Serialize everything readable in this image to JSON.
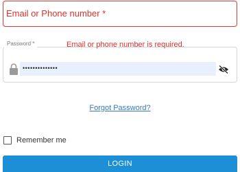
{
  "login_form": {
    "email": {
      "label": "Email or Phone number *",
      "value": ""
    },
    "password": {
      "label": "Password *",
      "error": "Email or phone number is required.",
      "value_masked": "••••••••••••••"
    },
    "forgot_password": "Forgot Password?",
    "remember_me": {
      "label": "Remember me",
      "checked": false
    },
    "login_button": "LOGIN"
  },
  "colors": {
    "error": "#e0302b",
    "link": "#3679c2",
    "primary_button": "#1c8fd6",
    "autofill_background": "#e8f0fe"
  }
}
